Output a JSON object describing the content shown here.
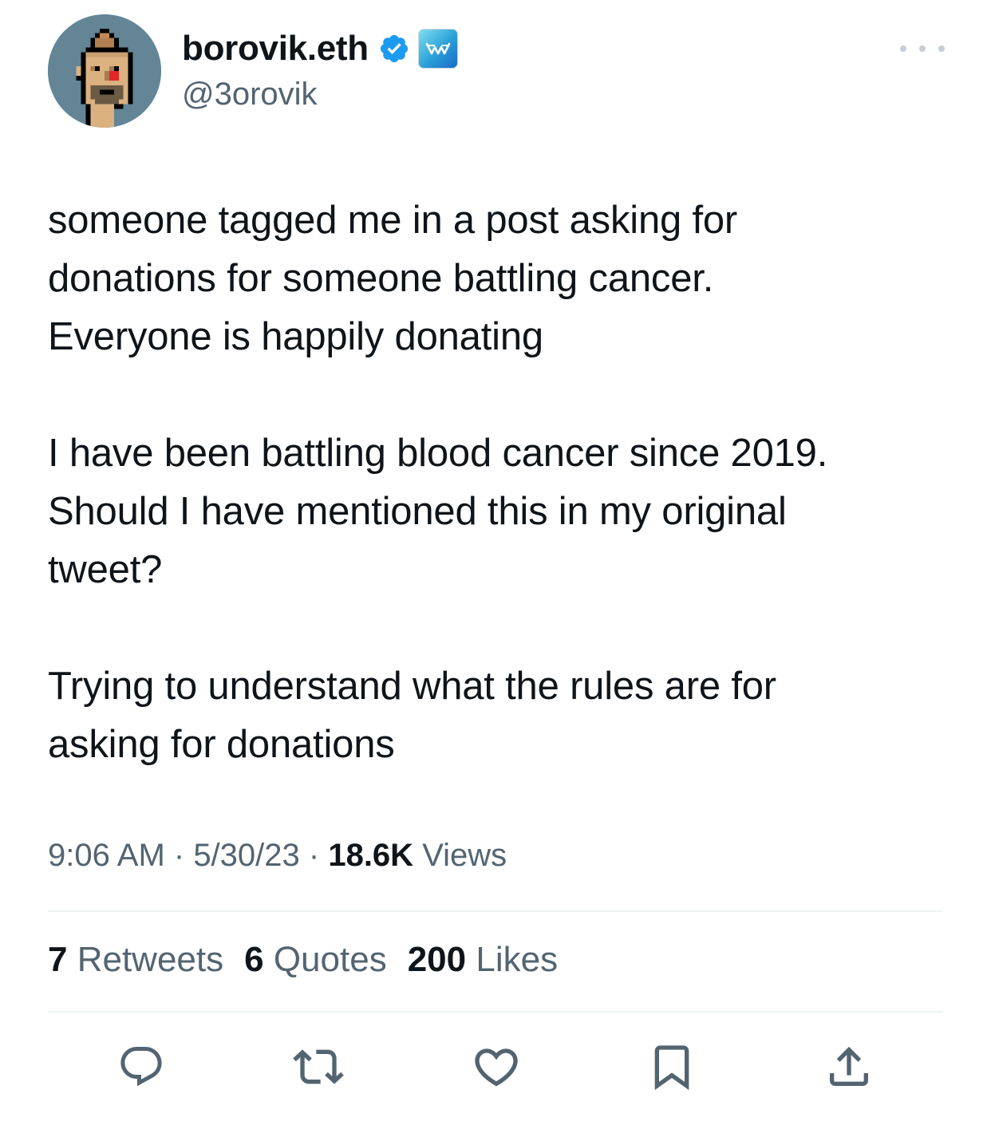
{
  "author": {
    "display_name": "borovik.eth",
    "handle": "@3orovik",
    "verified_icon": "verified-badge-icon",
    "affiliate_icon": "affiliate-badge-icon",
    "avatar": "cryptopunk-avatar"
  },
  "more_icon": "more-options-icon",
  "tweet": {
    "paragraphs": [
      "someone tagged me in a post asking for\ndonations for someone battling cancer.\nEveryone is happily donating",
      "I have been battling blood cancer since 2019.\nShould I have mentioned this in my original\ntweet?",
      "Trying to understand what the rules are for\nasking for donations"
    ]
  },
  "meta": {
    "time": "9:06 AM",
    "sep1": " · ",
    "date": "5/30/23",
    "sep2": " · ",
    "views_count": "18.6K",
    "views_label": " Views"
  },
  "stats": {
    "retweets_count": "7",
    "retweets_label": " Retweets",
    "quotes_count": "6",
    "quotes_label": " Quotes",
    "likes_count": "200",
    "likes_label": " Likes"
  },
  "actions": {
    "reply_icon": "reply-icon",
    "retweet_icon": "retweet-icon",
    "like_icon": "heart-icon",
    "bookmark_icon": "bookmark-icon",
    "share_icon": "share-icon"
  },
  "colors": {
    "text_primary": "#0f1419",
    "text_secondary": "#536471",
    "verified_blue": "#1d9bf0",
    "divider": "#eff3f4",
    "avatar_bg": "#638596"
  }
}
